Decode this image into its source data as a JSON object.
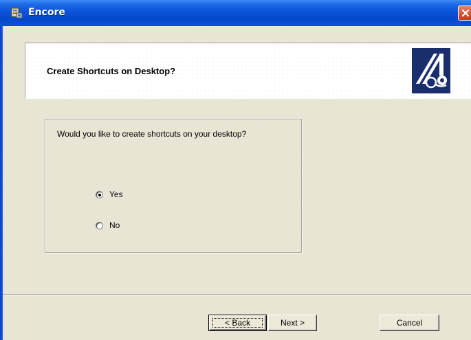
{
  "window": {
    "title": "Encore",
    "icon": "installer-app-icon",
    "close_icon": "close-icon"
  },
  "header": {
    "title": "Create Shortcuts on Desktop?",
    "logo": "encore-logo"
  },
  "options": {
    "question": "Would you like to create shortcuts on your desktop?",
    "yes_label": "Yes",
    "no_label": "No",
    "selected": "Yes"
  },
  "buttons": {
    "back_label": "< Back",
    "next_label": "Next >",
    "cancel_label": "Cancel"
  },
  "colors": {
    "titlebar": "#0a54d8",
    "close": "#d45a3c",
    "dialog_bg": "#ece9d8",
    "logo_bg": "#1a2e6e"
  }
}
